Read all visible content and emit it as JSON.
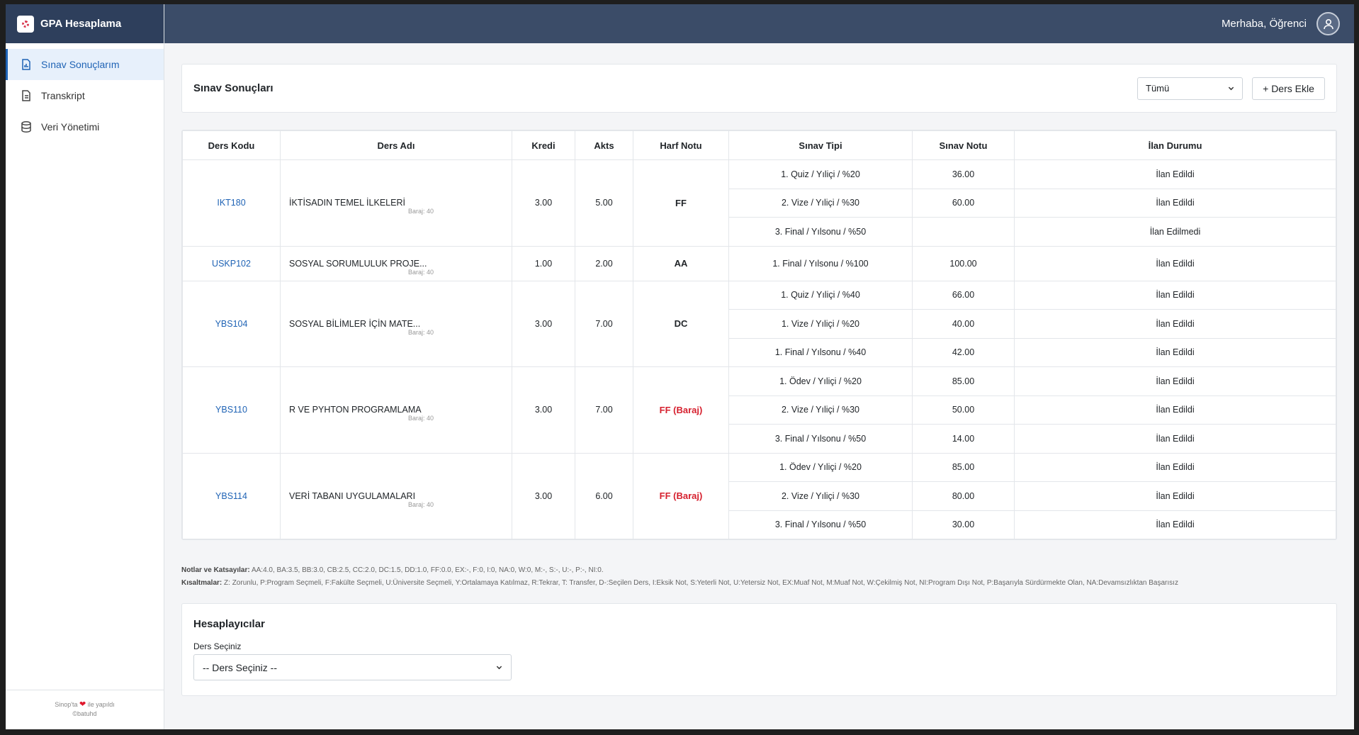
{
  "brand": {
    "name": "GPA Hesaplama"
  },
  "topbar": {
    "greeting": "Merhaba, Öğrenci"
  },
  "sidebar": {
    "items": [
      {
        "label": "Sınav Sonuçlarım"
      },
      {
        "label": "Transkript"
      },
      {
        "label": "Veri Yönetimi"
      }
    ],
    "footer_line1_a": "Sinop'ta",
    "footer_line1_b": "ile yapıldı",
    "footer_line2": "©batuhd"
  },
  "header": {
    "title": "Sınav Sonuçları",
    "filter_value": "Tümü",
    "add_button": "+ Ders Ekle"
  },
  "table": {
    "headers": [
      "Ders Kodu",
      "Ders Adı",
      "Kredi",
      "Akts",
      "Harf Notu",
      "Sınav Tipi",
      "Sınav Notu",
      "İlan Durumu"
    ],
    "courses": [
      {
        "code": "IKT180",
        "name": "İKTİSADIN TEMEL İLKELERİ",
        "baraj": "Baraj: 40",
        "kredi": "3.00",
        "akts": "5.00",
        "grade": "FF",
        "fail": false,
        "exams": [
          {
            "type": "1. Quiz / Yıliçi / %20",
            "score": "36.00",
            "status": "İlan Edildi"
          },
          {
            "type": "2. Vize / Yıliçi / %30",
            "score": "60.00",
            "status": "İlan Edildi"
          },
          {
            "type": "3. Final / Yılsonu / %50",
            "score": "",
            "status": "İlan Edilmedi"
          }
        ]
      },
      {
        "code": "USKP102",
        "name": "SOSYAL SORUMLULUK PROJE...",
        "baraj": "Baraj: 40",
        "kredi": "1.00",
        "akts": "2.00",
        "grade": "AA",
        "fail": false,
        "exams": [
          {
            "type": "1. Final / Yılsonu / %100",
            "score": "100.00",
            "status": "İlan Edildi"
          }
        ]
      },
      {
        "code": "YBS104",
        "name": "SOSYAL BİLİMLER İÇİN MATE...",
        "baraj": "Baraj: 40",
        "kredi": "3.00",
        "akts": "7.00",
        "grade": "DC",
        "fail": false,
        "exams": [
          {
            "type": "1. Quiz / Yıliçi / %40",
            "score": "66.00",
            "status": "İlan Edildi"
          },
          {
            "type": "1. Vize / Yıliçi / %20",
            "score": "40.00",
            "status": "İlan Edildi"
          },
          {
            "type": "1. Final / Yılsonu / %40",
            "score": "42.00",
            "status": "İlan Edildi"
          }
        ]
      },
      {
        "code": "YBS110",
        "name": "R VE PYHTON PROGRAMLAMA",
        "baraj": "Baraj: 40",
        "kredi": "3.00",
        "akts": "7.00",
        "grade": "FF (Baraj)",
        "fail": true,
        "exams": [
          {
            "type": "1. Ödev / Yıliçi / %20",
            "score": "85.00",
            "status": "İlan Edildi"
          },
          {
            "type": "2. Vize / Yıliçi / %30",
            "score": "50.00",
            "status": "İlan Edildi"
          },
          {
            "type": "3. Final / Yılsonu / %50",
            "score": "14.00",
            "status": "İlan Edildi"
          }
        ]
      },
      {
        "code": "YBS114",
        "name": "VERİ TABANI UYGULAMALARI",
        "baraj": "Baraj: 40",
        "kredi": "3.00",
        "akts": "6.00",
        "grade": "FF (Baraj)",
        "fail": true,
        "exams": [
          {
            "type": "1. Ödev / Yıliçi / %20",
            "score": "85.00",
            "status": "İlan Edildi"
          },
          {
            "type": "2. Vize / Yıliçi / %30",
            "score": "80.00",
            "status": "İlan Edildi"
          },
          {
            "type": "3. Final / Yılsonu / %50",
            "score": "30.00",
            "status": "İlan Edildi"
          }
        ]
      }
    ]
  },
  "notes": {
    "grades_label": "Notlar ve Katsayılar:",
    "grades_text": "AA:4.0, BA:3.5, BB:3.0, CB:2.5, CC:2.0, DC:1.5, DD:1.0, FF:0.0, EX:-, F:0, I:0, NA:0, W:0, M:-, S:-, U:-, P:-, NI:0.",
    "abbr_label": "Kısaltmalar:",
    "abbr_text": "Z: Zorunlu, P:Program Seçmeli, F:Fakülte Seçmeli, U:Üniversite Seçmeli, Y:Ortalamaya Katılmaz, R:Tekrar, T: Transfer, D-:Seçilen Ders, I:Eksik Not, S:Yeterli Not, U:Yetersiz Not, EX:Muaf Not, M:Muaf Not, W:Çekilmiş Not, NI:Program Dışı Not, P:Başarıyla Sürdürmekte Olan, NA:Devamsızlıktan Başarısız"
  },
  "calculators": {
    "title": "Hesaplayıcılar",
    "label": "Ders Seçiniz",
    "select_value": "-- Ders Seçiniz --"
  },
  "colors": {
    "sidebar_brand": "#2e3f5c",
    "topbar": "#3b4c68",
    "link": "#1f63b5",
    "fail": "#d6212f"
  }
}
